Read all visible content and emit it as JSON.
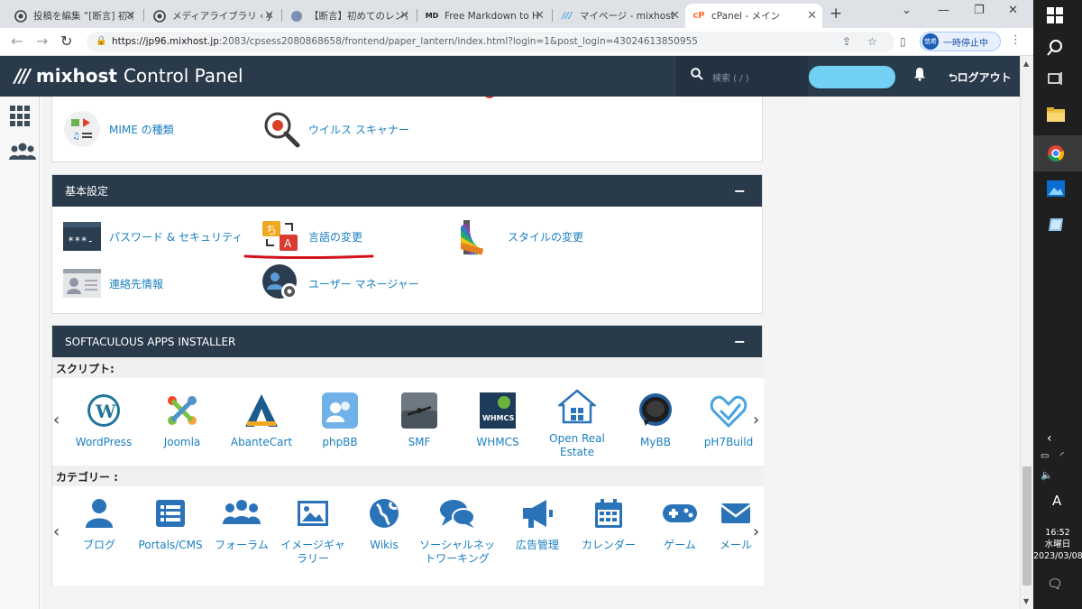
{
  "browser": {
    "tabs": [
      {
        "title": "投稿を編集 “[断言] 初めてのレン",
        "favicon": "wordpress-icon"
      },
      {
        "title": "メディアライブラリ ‹ yuk",
        "favicon": "wordpress-icon"
      },
      {
        "title": "【断言】初めてのレンタ",
        "favicon": "blog-icon"
      },
      {
        "title": "Free Markdown to H",
        "favicon": "md-icon"
      },
      {
        "title": "マイページ - mixhost",
        "favicon": "mixhost-icon"
      },
      {
        "title": "cPanel - メイン",
        "favicon": "cpanel-icon",
        "active": true
      }
    ],
    "url_host": "https://jp96.mixhost.jp",
    "url_path": ":2083/cpsess2080868658/frontend/paper_lantern/index.html?login=1&post_login=43024613850955",
    "profile_initials": "悠希",
    "profile_label": "一時停止中"
  },
  "header": {
    "brand": "mixhost",
    "product": "Control Panel",
    "search_placeholder": "検索 ( / )",
    "logout_label": "ログアウト"
  },
  "sections": {
    "advanced_partial": {
      "items": [
        {
          "label": "MIME の種類",
          "icon": "mime-icon"
        },
        {
          "label": "ウイルス スキャナー",
          "icon": "virus-scanner-icon"
        }
      ]
    },
    "preferences": {
      "title": "基本設定",
      "collapse_symbol": "−",
      "items": [
        {
          "label": "パスワード & セキュリティ",
          "icon": "password-icon"
        },
        {
          "label": "言語の変更",
          "icon": "language-icon"
        },
        {
          "label": "スタイルの変更",
          "icon": "style-icon"
        },
        {
          "label": "連絡先情報",
          "icon": "contact-icon"
        },
        {
          "label": "ユーザー マネージャー",
          "icon": "user-manager-icon"
        }
      ]
    },
    "softaculous": {
      "title": "SOFTACULOUS APPS INSTALLER",
      "collapse_symbol": "−",
      "scripts_label": "スクリプト:",
      "apps": [
        {
          "name": "WordPress",
          "icon": "wordpress-icon"
        },
        {
          "name": "Joomla",
          "icon": "joomla-icon"
        },
        {
          "name": "AbanteCart",
          "icon": "abantecart-icon"
        },
        {
          "name": "phpBB",
          "icon": "phpbb-icon"
        },
        {
          "name": "SMF",
          "icon": "smf-icon"
        },
        {
          "name": "WHMCS",
          "icon": "whmcs-icon"
        },
        {
          "name": "Open Real Estate",
          "icon": "open-real-estate-icon"
        },
        {
          "name": "MyBB",
          "icon": "mybb-icon"
        },
        {
          "name": "pH7Build",
          "icon": "ph7builder-icon"
        }
      ],
      "categories_label": "カテゴリー :",
      "categories": [
        {
          "name": "ブログ",
          "icon": "person-icon"
        },
        {
          "name": "Portals/CMS",
          "icon": "list-icon"
        },
        {
          "name": "フォーラム",
          "icon": "users-icon"
        },
        {
          "name": "イメージギャラリー",
          "icon": "image-icon"
        },
        {
          "name": "Wikis",
          "icon": "globe-icon"
        },
        {
          "name": "ソーシャルネットワーキング",
          "icon": "chat-icon"
        },
        {
          "name": "広告管理",
          "icon": "megaphone-icon"
        },
        {
          "name": "カレンダー",
          "icon": "calendar-icon"
        },
        {
          "name": "ゲーム",
          "icon": "gamepad-icon"
        },
        {
          "name": "メール",
          "icon": "envelope-icon"
        }
      ]
    }
  },
  "taskbar": {
    "input_indicator": "A",
    "time": "16:52",
    "weekday": "水曜日",
    "date": "2023/03/08"
  },
  "colors": {
    "header_bg": "#293a4a",
    "link": "#1a7fc1",
    "annotation_underline": "#d4121b",
    "taskbar_bg": "#1f1f1f"
  }
}
